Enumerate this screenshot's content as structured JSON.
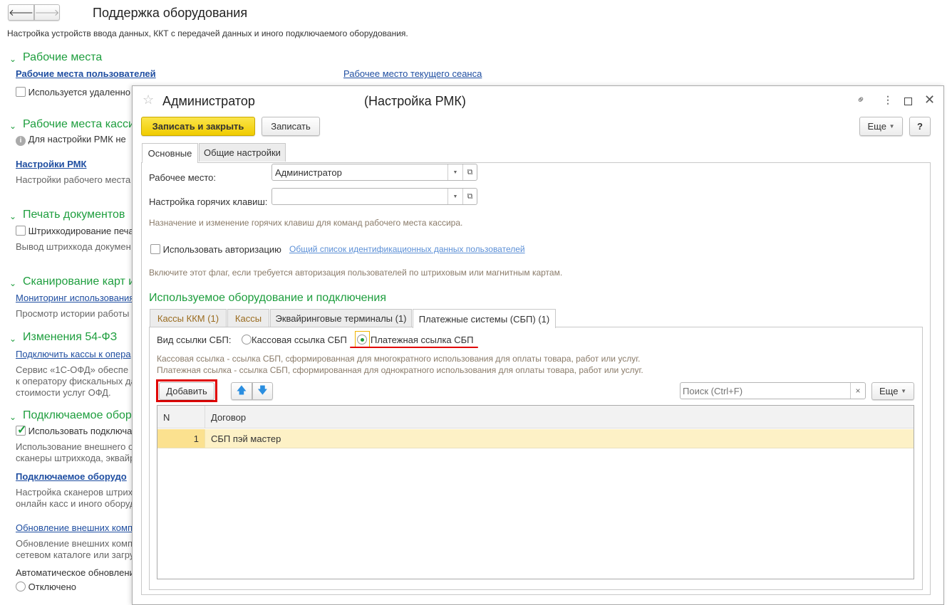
{
  "page": {
    "title": "Поддержка оборудования",
    "subtitle": "Настройка устройств ввода данных, ККТ с передачей данных и иного подключаемого оборудования.",
    "sections": {
      "s1": {
        "title": "Рабочие места",
        "link": "Рабочие места пользователей",
        "link_right": "Рабочее место текущего сеанса",
        "checkbox": "Используется удаленно"
      },
      "s2": {
        "title": "Рабочие места касси",
        "info": "Для настройки РМК не",
        "link": "Настройки РМК",
        "desc": "Настройки рабочего места"
      },
      "s3": {
        "title": "Печать документов",
        "checkbox": "Штрихкодирование печа",
        "desc": "Вывод штрихкода докумен"
      },
      "s4": {
        "title": "Сканирование карт и",
        "link": "Мониторинг использования",
        "desc": "Просмотр истории работы с"
      },
      "s5": {
        "title": "Изменения 54-ФЗ",
        "link": "Подключить кассы к опера",
        "desc1": "Сервис  «1С-ОФД» обеспе",
        "desc2": "к оператору фискальных да",
        "desc3": "стоимости услуг ОФД."
      },
      "s6": {
        "title": "Подключаемое обор",
        "checkbox": "Использовать подключа",
        "desc1": "Использование внешнего о",
        "desc2": "сканеры штрихкода, эквайр",
        "link": "Подключаемое оборудо",
        "desc3": "Настройка сканеров штрих",
        "desc4": "онлайн касс и иного оборуд",
        "link2": "Обновление внешних комп",
        "desc5": "Обновление внешних комп",
        "desc6": "сетевом каталоге или загру",
        "auto": "Автоматическое обновлени",
        "radio": "Отключено"
      }
    }
  },
  "dialog": {
    "title": "Администратор",
    "title_suffix": "(Настройка РМК)",
    "save_close": "Записать и закрыть",
    "save": "Записать",
    "more": "Еще",
    "help": "?",
    "tabs": [
      "Основные",
      "Общие настройки"
    ],
    "workplace_label": "Рабочее место:",
    "workplace_value": "Администратор",
    "hotkeys_label": "Настройка горячих клавиш:",
    "hotkeys_value": "",
    "hotkeys_hint": "Назначение и изменение горячих клавиш для команд рабочего места кассира.",
    "auth_label": "Использовать авторизацию",
    "auth_link": "Общий список идентификационных данных пользователей",
    "auth_hint": "Включите этот флаг, если требуется авторизация пользователей по штриховым или магнитным картам.",
    "equip_title": "Используемое оборудование и подключения",
    "equip_tabs": [
      "Кассы ККМ (1)",
      "Кассы",
      "Эквайринговые терминалы (1)",
      "Платежные системы (СБП) (1)"
    ],
    "sbp_label": "Вид ссылки СБП:",
    "sbp_opt1": "Кассовая ссылка СБП",
    "sbp_opt2": "Платежная ссылка СБП",
    "sbp_selected": "Платежная ссылка СБП",
    "sbp_hint1": "Кассовая ссылка - ссылка СБП, сформированная для многократного использования для оплаты товара, работ или услуг.",
    "sbp_hint2": "Платежная ссылка - ссылка СБП, сформированная для однократного использования для оплаты товара, работ или услуг.",
    "add": "Добавить",
    "search_placeholder": "Поиск (Ctrl+F)",
    "search_clear": "×",
    "table_more": "Еще",
    "columns": [
      "N",
      "Договор"
    ],
    "rows": [
      {
        "n": "1",
        "contract": "СБП пэй мастер"
      }
    ]
  },
  "colors": {
    "accent_green": "#1e9e3e",
    "primary_yellow": "#f5d40f",
    "highlight": "#e00000",
    "row_selected": "#fdf1c6"
  }
}
